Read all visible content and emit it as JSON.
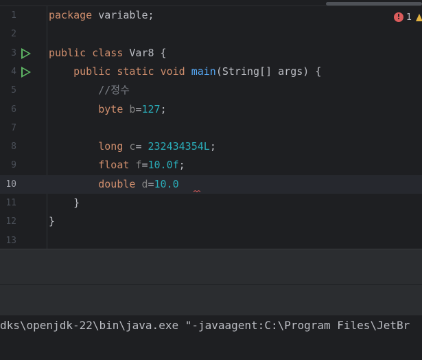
{
  "editor": {
    "error_count": "1",
    "colors": {
      "keyword": "#cf8e6d",
      "default": "#bcbec4",
      "method": "#56a8f5",
      "number": "#2aacb8",
      "comment": "#7a7e85",
      "unused_var": "#808080",
      "error": "#db5c5c",
      "warning": "#e3b341",
      "run_gutter": "#5fb865"
    },
    "lines": [
      {
        "num": "1",
        "tokens": [
          {
            "t": "package",
            "c": "keyword"
          },
          {
            "t": " variable;",
            "c": "default"
          }
        ]
      },
      {
        "num": "2",
        "tokens": []
      },
      {
        "num": "3",
        "run": true,
        "tokens": [
          {
            "t": "public",
            "c": "keyword"
          },
          {
            "t": " ",
            "c": "default"
          },
          {
            "t": "class",
            "c": "keyword"
          },
          {
            "t": " Var8 {",
            "c": "default"
          }
        ]
      },
      {
        "num": "4",
        "run": true,
        "tokens": [
          {
            "t": "    ",
            "c": "default"
          },
          {
            "t": "public",
            "c": "keyword"
          },
          {
            "t": " ",
            "c": "default"
          },
          {
            "t": "static",
            "c": "keyword"
          },
          {
            "t": " ",
            "c": "default"
          },
          {
            "t": "void",
            "c": "keyword"
          },
          {
            "t": " ",
            "c": "default"
          },
          {
            "t": "main",
            "c": "method"
          },
          {
            "t": "(String[] args) {",
            "c": "default"
          }
        ]
      },
      {
        "num": "5",
        "tokens": [
          {
            "t": "        ",
            "c": "default"
          },
          {
            "t": "//정수",
            "c": "comment"
          }
        ]
      },
      {
        "num": "6",
        "tokens": [
          {
            "t": "        ",
            "c": "default"
          },
          {
            "t": "byte",
            "c": "keyword"
          },
          {
            "t": " ",
            "c": "default"
          },
          {
            "t": "b",
            "c": "unused_var"
          },
          {
            "t": "=",
            "c": "default"
          },
          {
            "t": "127",
            "c": "number"
          },
          {
            "t": ";",
            "c": "default"
          }
        ]
      },
      {
        "num": "7",
        "tokens": []
      },
      {
        "num": "8",
        "tokens": [
          {
            "t": "        ",
            "c": "default"
          },
          {
            "t": "long",
            "c": "keyword"
          },
          {
            "t": " ",
            "c": "default"
          },
          {
            "t": "c",
            "c": "unused_var"
          },
          {
            "t": "= ",
            "c": "default"
          },
          {
            "t": "232434354L",
            "c": "number"
          },
          {
            "t": ";",
            "c": "default"
          }
        ]
      },
      {
        "num": "9",
        "tokens": [
          {
            "t": "        ",
            "c": "default"
          },
          {
            "t": "float",
            "c": "keyword"
          },
          {
            "t": " ",
            "c": "default"
          },
          {
            "t": "f",
            "c": "unused_var"
          },
          {
            "t": "=",
            "c": "default"
          },
          {
            "t": "10.0f",
            "c": "number"
          },
          {
            "t": ";",
            "c": "default"
          }
        ]
      },
      {
        "num": "10",
        "current": true,
        "tokens": [
          {
            "t": "        ",
            "c": "default"
          },
          {
            "t": "double",
            "c": "keyword"
          },
          {
            "t": " ",
            "c": "default"
          },
          {
            "t": "d",
            "c": "unused_var"
          },
          {
            "t": "=",
            "c": "default"
          },
          {
            "t": "10.0",
            "c": "number"
          }
        ]
      },
      {
        "num": "11",
        "tokens": [
          {
            "t": "    }",
            "c": "default"
          }
        ]
      },
      {
        "num": "12",
        "tokens": [
          {
            "t": "}",
            "c": "default"
          }
        ]
      },
      {
        "num": "13",
        "tokens": []
      }
    ]
  },
  "console": {
    "command": "dks\\openjdk-22\\bin\\java.exe \"-javaagent:C:\\Program Files\\JetBr"
  }
}
